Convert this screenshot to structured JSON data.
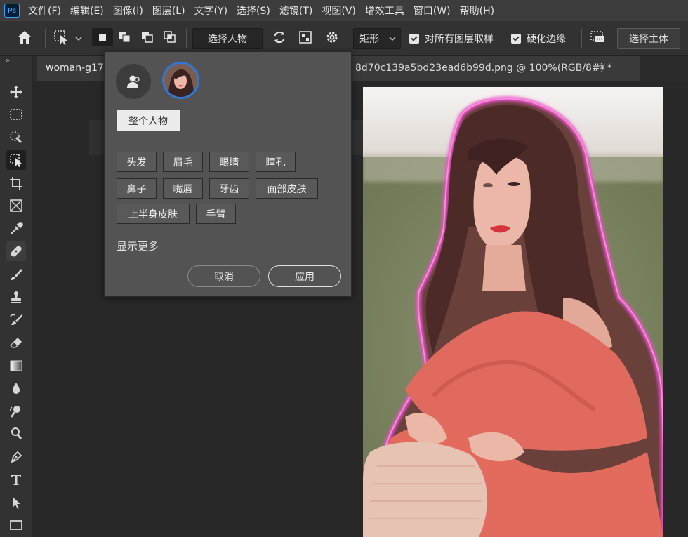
{
  "app": {
    "logo": "Ps"
  },
  "menu": [
    "文件(F)",
    "编辑(E)",
    "图像(I)",
    "图层(L)",
    "文字(Y)",
    "选择(S)",
    "滤镜(T)",
    "视图(V)",
    "增效工具",
    "窗口(W)",
    "帮助(H)"
  ],
  "options_bar": {
    "subject_dropdown": "选择人物",
    "mode_dropdown": "矩形",
    "sample_all_layers": {
      "label": "对所有图层取样",
      "checked": true
    },
    "hard_edge": {
      "label": "硬化边缘",
      "checked": true
    },
    "select_subject_button": "选择主体"
  },
  "document": {
    "tab_title_left": "woman-g17",
    "tab_title_right": "8d70c139a5bd23ead6b99d.png @ 100%(RGB/8#) *",
    "close_glyph": "×"
  },
  "popup": {
    "whole_person": "整个人物",
    "parts": [
      "头发",
      "眉毛",
      "眼睛",
      "瞳孔",
      "鼻子",
      "嘴唇",
      "牙齿",
      "面部皮肤",
      "上半身皮肤",
      "手臂"
    ],
    "show_more": "显示更多",
    "cancel": "取消",
    "apply": "应用"
  },
  "toolbar": {
    "tools": [
      "move-tool",
      "marquee-tool",
      "quick-selection-tool",
      "object-selection-tool",
      "crop-tool",
      "frame-tool",
      "eyedropper-tool",
      "healing-brush-tool",
      "brush-tool",
      "clone-stamp-tool",
      "history-brush-tool",
      "eraser-tool",
      "gradient-tool",
      "blur-tool",
      "dodge-tool",
      "pen-tool",
      "type-tool",
      "path-selection-tool",
      "rectangle-tool"
    ],
    "active": "object-selection-tool"
  },
  "colors": {
    "selection_outline": "#e44fc1",
    "accent": "#2f78d6",
    "panel": "#535353"
  }
}
